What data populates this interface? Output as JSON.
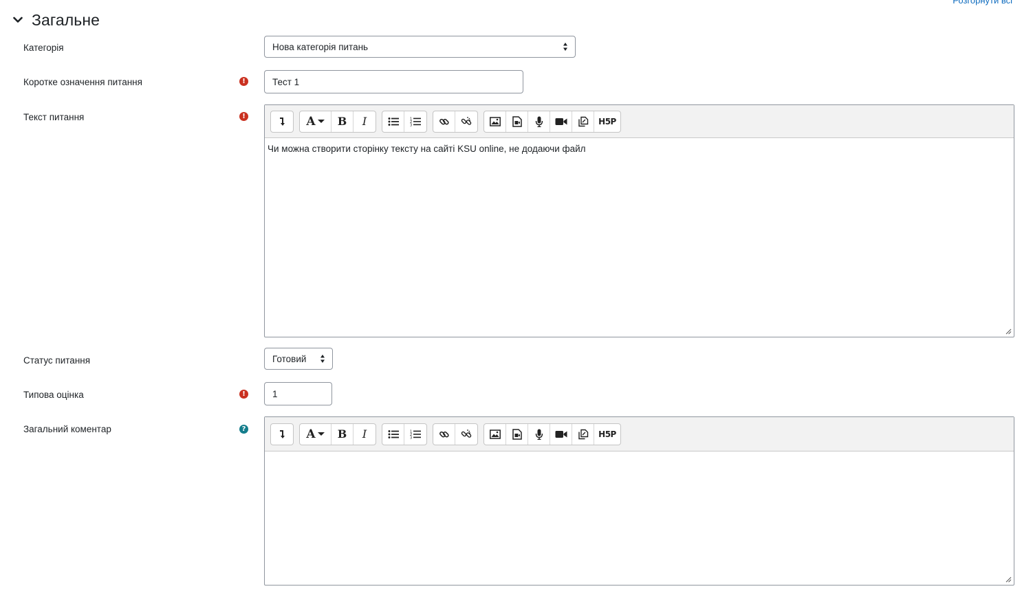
{
  "header": {
    "expand_all": "Розгорнути всі"
  },
  "section": {
    "title": "Загальне",
    "icon": "chevron-down-icon"
  },
  "fields": {
    "category": {
      "label": "Категорія",
      "value": "Нова категорія питань"
    },
    "name": {
      "label": "Коротке означення питання",
      "value": "Тест 1",
      "required": true
    },
    "questiontext": {
      "label": "Текст питання",
      "required": true,
      "content": "Чи можна створити сторінку тексту на сайті KSU online, не додаючи файл"
    },
    "status": {
      "label": "Статус питання",
      "value": "Готовий"
    },
    "defaultmark": {
      "label": "Типова оцінка",
      "value": "1",
      "required": true
    },
    "generalfeedback": {
      "label": "Загальний коментар",
      "content": "",
      "has_help": true
    }
  },
  "toolbar": {
    "items": [
      "show-more-icon",
      "font-color-icon",
      "bold-icon",
      "italic-icon",
      "unordered-list-icon",
      "ordered-list-icon",
      "link-icon",
      "unlink-icon",
      "image-icon",
      "media-icon",
      "record-audio-icon",
      "record-video-icon",
      "manage-files-icon",
      "h5p-icon"
    ],
    "bold": "B",
    "italic": "I",
    "font": "A",
    "h5p": "H5P"
  },
  "colors": {
    "required": "#ca3120",
    "help": "#147d8c",
    "link": "#0f6cbf",
    "toolbar_bg": "#f2f2f2"
  }
}
